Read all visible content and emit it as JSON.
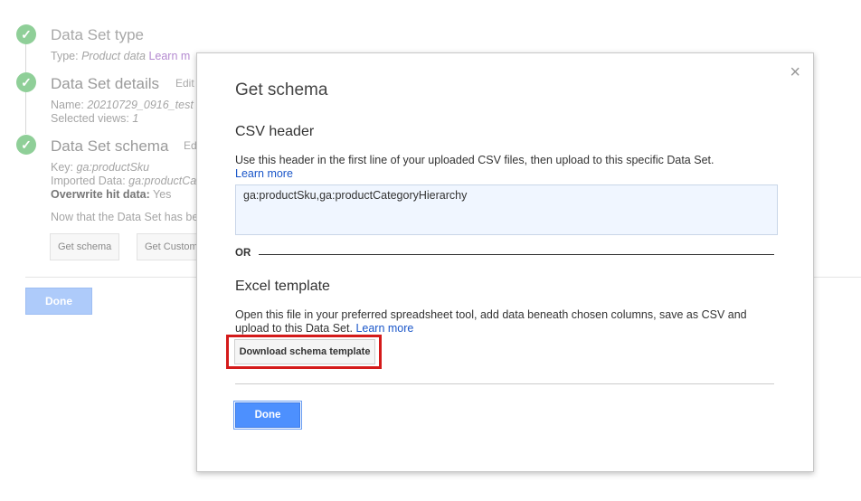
{
  "wizard": {
    "step1": {
      "title": "Data Set type",
      "type_label": "Type:",
      "type_value": "Product data",
      "learn_more": "Learn m"
    },
    "step2": {
      "title": "Data Set details",
      "edit": "Edit",
      "name_label": "Name:",
      "name_value": "20210729_0916_test",
      "views_label": "Selected views:",
      "views_value": "1"
    },
    "step3": {
      "title": "Data Set schema",
      "edit": "Ed",
      "key_label": "Key:",
      "key_value": "ga:productSku",
      "imported_label": "Imported Data:",
      "imported_value": "ga:productCa",
      "overwrite_label": "Overwrite hit data:",
      "overwrite_value": "Yes",
      "note": "Now that the Data Set has be",
      "get_schema": "Get schema",
      "get_custom": "Get Custom"
    },
    "done": "Done"
  },
  "dialog": {
    "title": "Get schema",
    "close": "×",
    "csv": {
      "title": "CSV header",
      "desc": "Use this header in the first line of your uploaded CSV files, then upload to this specific Data Set.",
      "learn_more": "Learn more",
      "header_value": "ga:productSku,ga:productCategoryHierarchy"
    },
    "or": "OR",
    "excel": {
      "title": "Excel template",
      "desc": "Open this file in your preferred spreadsheet tool, add data beneath chosen columns, save as CSV and upload to this Data Set.",
      "learn_more": "Learn more",
      "download": "Download schema template"
    },
    "done": "Done"
  },
  "colors": {
    "check": "#8fcf98",
    "primary": "#4d90fe",
    "highlight": "#d41a1a",
    "link": "#1a56c9"
  }
}
